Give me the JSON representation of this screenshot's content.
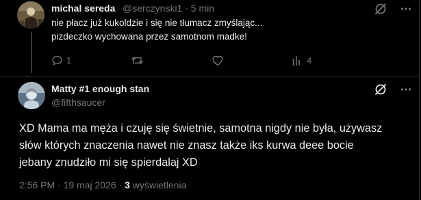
{
  "reply_tweet": {
    "author_name": "michal sereda",
    "author_handle": "@serczynski1",
    "separator": "·",
    "time": "5 min",
    "text_lines": [
      "nie płacz już kukoldzie i się nie tłumacz zmyślając...",
      "pizdeczko wychowana przez samotnom madke!"
    ],
    "reply_count": "1",
    "repost_count": "",
    "like_count": "",
    "views_count": "4"
  },
  "main_tweet": {
    "author_name": "Matty #1 enough stan",
    "author_handle": "@fifthsaucer",
    "text_lines": [
      "XD Mama ma męża i czuję się świetnie, samotna nigdy nie była, używasz",
      "słów których znaczenia nawet nie znasz także iks kurwa deee bocie",
      "jebany znudziło mi się spierdalaj XD"
    ],
    "timestamp": "2:56 PM · 19 maj 2026 · ",
    "views_count": "3",
    "views_label": " wyświetlenia"
  },
  "icons": {
    "grok": "grok-icon",
    "more": "more-icon",
    "reply": "reply-icon",
    "repost": "repost-icon",
    "like": "like-icon",
    "views": "views-icon"
  },
  "colors": {
    "background": "#000000",
    "text_primary": "#e7e9ea",
    "text_secondary": "#71767b",
    "divider": "#2f3336"
  }
}
